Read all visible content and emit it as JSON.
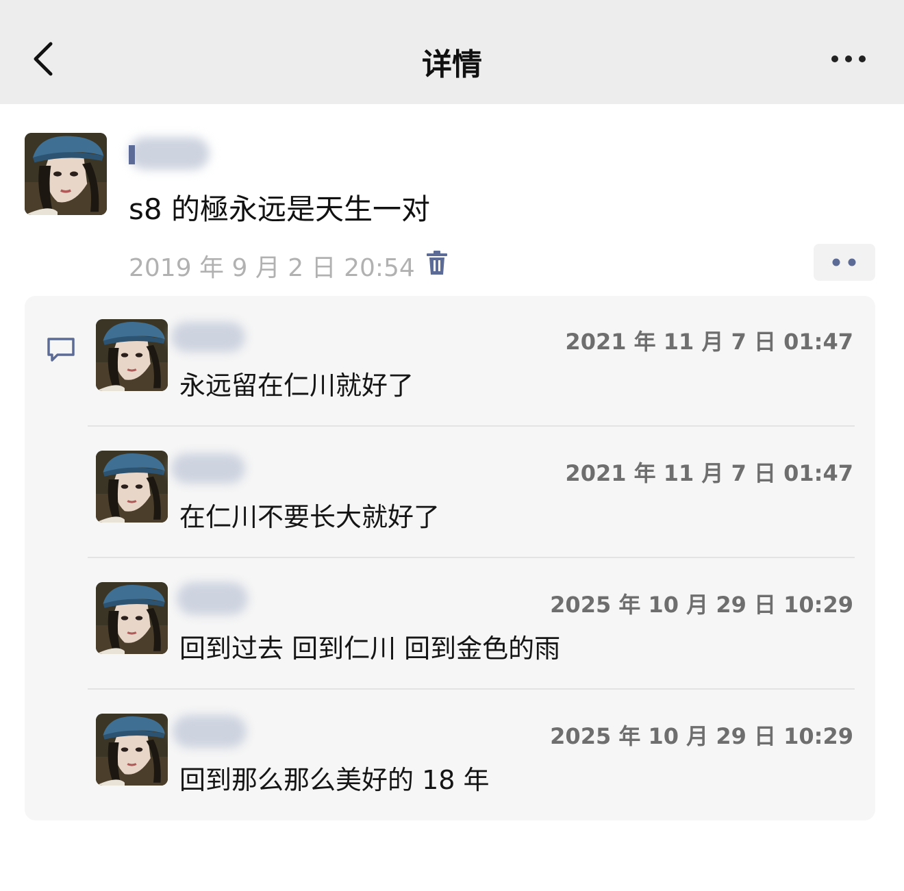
{
  "nav": {
    "title": "详情",
    "back_icon": "chevron-left-icon",
    "more_icon": "ellipsis-icon"
  },
  "post": {
    "text": "s8 的極永远是天生一对",
    "time": "2019 年 9 月 2 日 20:54",
    "delete_icon": "trash-icon",
    "actions_icon": "two-dots-icon"
  },
  "comments": [
    {
      "time": "2021 年 11 月 7 日 01:47",
      "text": "永远留在仁川就好了"
    },
    {
      "time": "2021 年 11 月 7 日 01:47",
      "text": "在仁川不要长大就好了"
    },
    {
      "time": "2025 年 10 月 29 日 10:29",
      "text": "回到过去 回到仁川 回到金色的雨"
    },
    {
      "time": "2025 年 10 月 29 日 10:29",
      "text": "回到那么那么美好的 18 年"
    }
  ],
  "colors": {
    "nav_bg": "#ededed",
    "accent": "#5b6b95",
    "comments_bg": "#f6f6f6",
    "muted_text": "#b1b1b1"
  }
}
